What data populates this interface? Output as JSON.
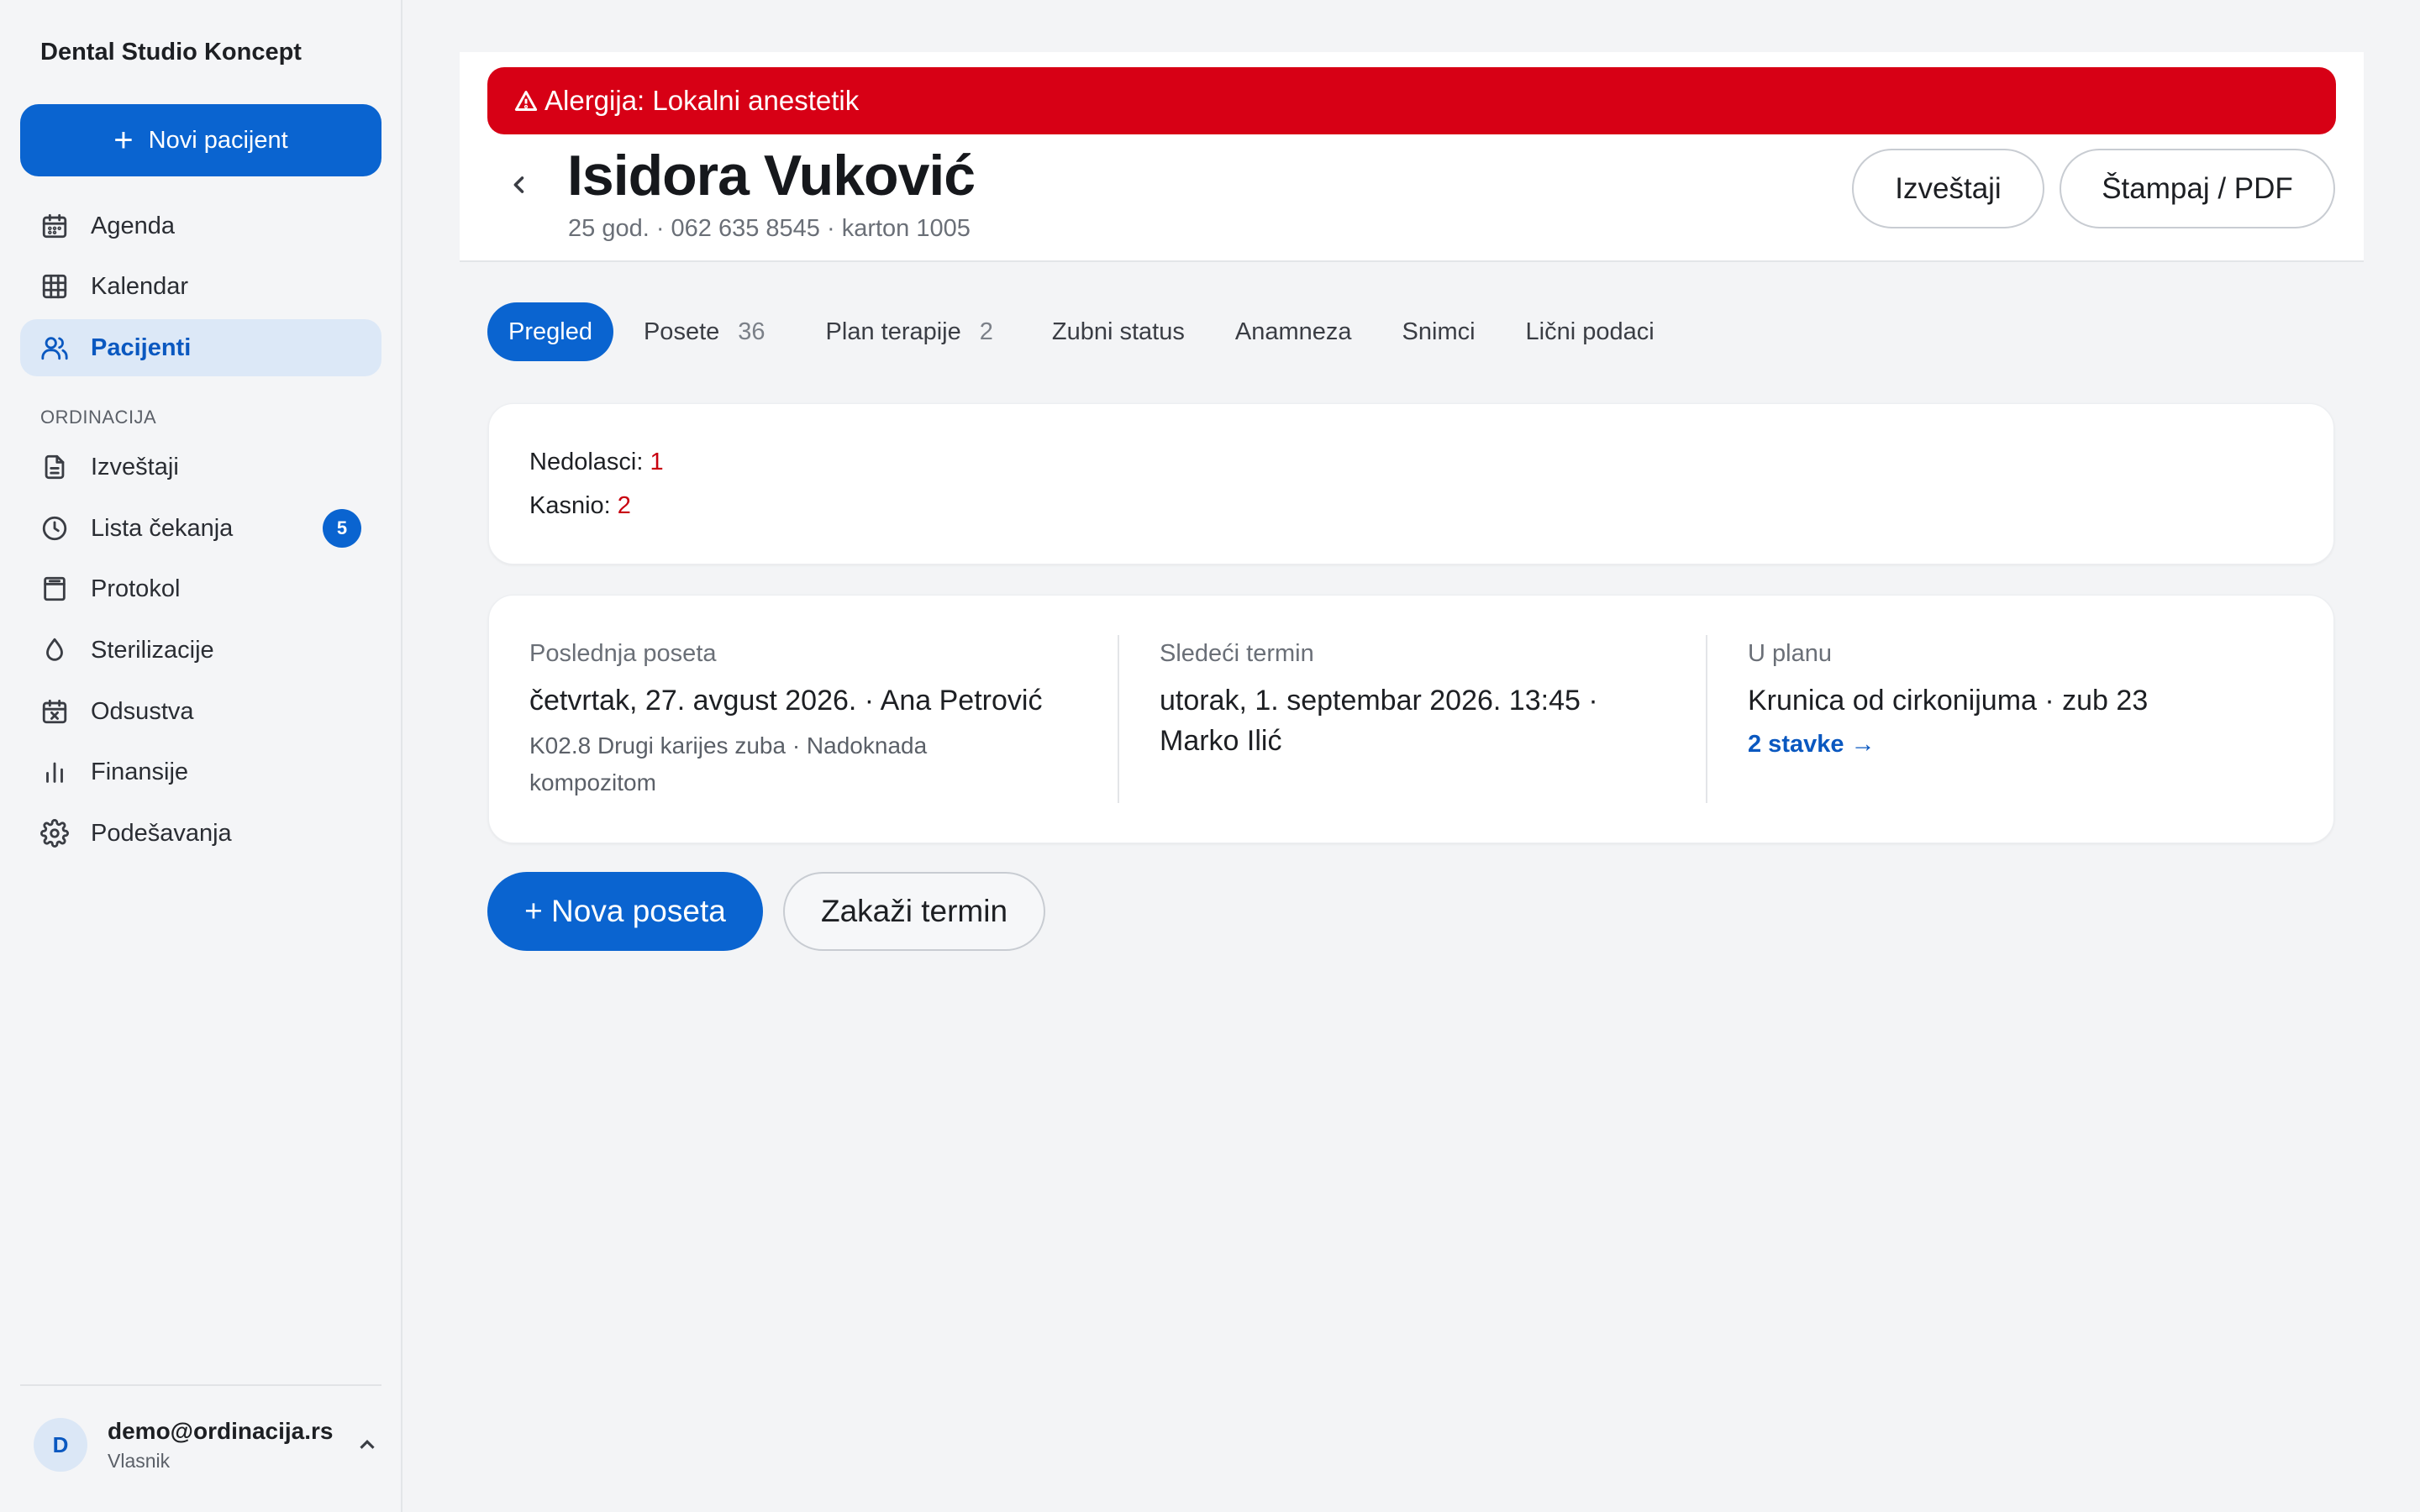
{
  "sidebar": {
    "brand": "Dental Studio Koncept",
    "new_patient": "Novi pacijent",
    "items": [
      {
        "label": "Agenda",
        "icon": "calendar-icon"
      },
      {
        "label": "Kalendar",
        "icon": "grid-calendar-icon"
      },
      {
        "label": "Pacijenti",
        "icon": "users-icon",
        "active": true
      }
    ],
    "section_label": "ORDINACIJA",
    "section_items": [
      {
        "label": "Izveštaji",
        "icon": "file-text-icon"
      },
      {
        "label": "Lista čekanja",
        "icon": "clock-icon",
        "badge": "5"
      },
      {
        "label": "Protokol",
        "icon": "archive-icon"
      },
      {
        "label": "Sterilizacije",
        "icon": "droplet-icon"
      },
      {
        "label": "Odsustva",
        "icon": "calendar-x-icon"
      },
      {
        "label": "Finansije",
        "icon": "bar-chart-icon"
      },
      {
        "label": "Podešavanja",
        "icon": "gear-icon"
      }
    ],
    "user": {
      "initial": "D",
      "email": "demo@ordinacija.rs",
      "role": "Vlasnik"
    }
  },
  "header": {
    "allergy": "Alergija: Lokalni anestetik",
    "name": "Isidora Vuković",
    "meta": "25 god. · 062 635 8545 · karton 1005",
    "reports_button": "Izveštaji",
    "print_button": "Štampaj / PDF"
  },
  "tabs": [
    {
      "label": "Pregled",
      "count": "",
      "active": true
    },
    {
      "label": "Posete",
      "count": "36"
    },
    {
      "label": "Plan terapije",
      "count": "2"
    },
    {
      "label": "Zubni status",
      "count": ""
    },
    {
      "label": "Anamneza",
      "count": ""
    },
    {
      "label": "Snimci",
      "count": ""
    },
    {
      "label": "Lični podaci",
      "count": ""
    }
  ],
  "stats": {
    "no_shows_label": "Nedolasci:",
    "no_shows_value": "1",
    "late_label": "Kasnio:",
    "late_value": "2"
  },
  "summary": {
    "last_visit_label": "Poslednja poseta",
    "last_visit_main": "četvrtak, 27. avgust 2026. · Ana Petrović",
    "last_visit_sub": "K02.8 Drugi karijes zuba · Nadoknada kompozitom",
    "next_label": "Sledeći termin",
    "next_main": "utorak, 1. septembar 2026. 13:45 · Marko Ilić",
    "plan_label": "U planu",
    "plan_main": "Krunica od cirkonijuma · zub 23",
    "plan_link": "2 stavke →"
  },
  "actions": {
    "new_visit": "+ Nova poseta",
    "schedule": "Zakaži termin"
  },
  "colors": {
    "accent": "#0a64d0",
    "allergy": "#d70015",
    "warning_text": "#c8000f"
  }
}
